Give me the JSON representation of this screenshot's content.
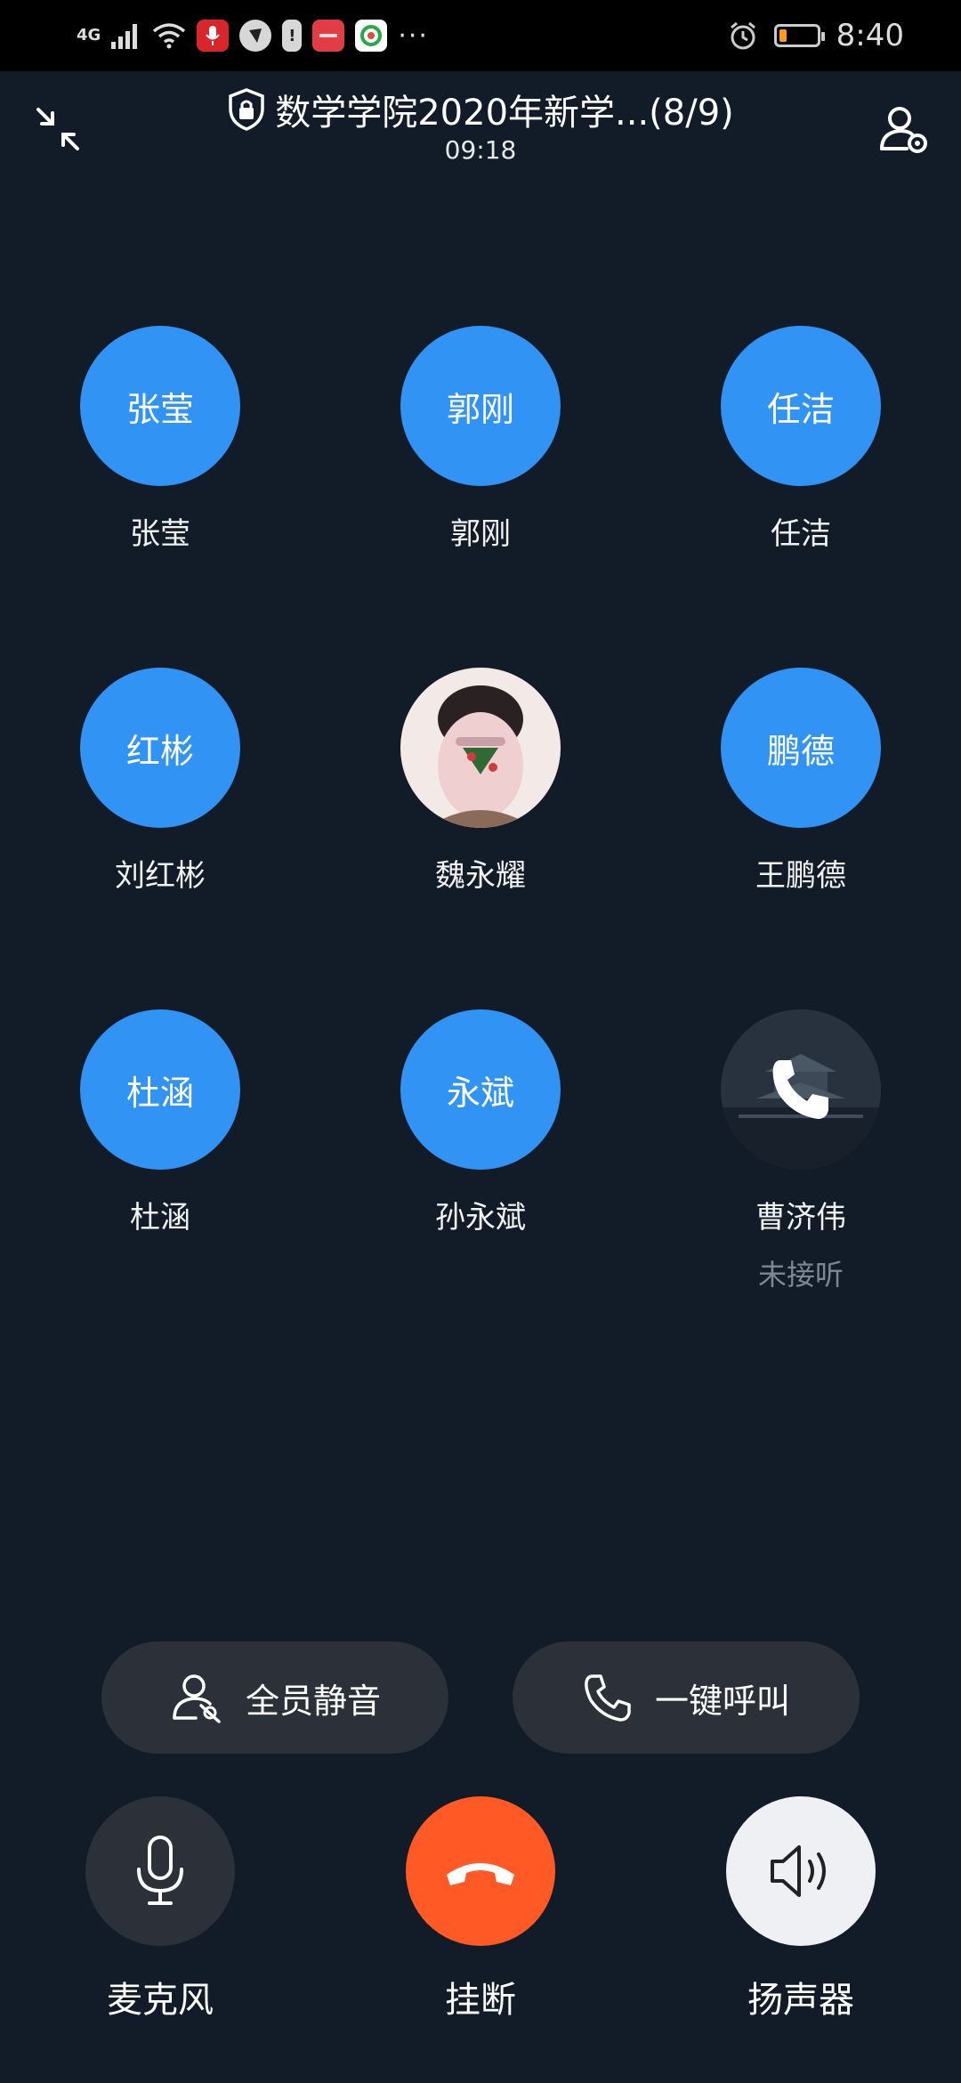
{
  "status_bar": {
    "network": "4G",
    "time": "8:40",
    "more": "···",
    "icons": [
      "signal-icon",
      "wifi-icon",
      "mic-app-icon",
      "shield-app-icon",
      "alert-icon",
      "huawei-app-icon",
      "camera-app-icon",
      "alarm-icon",
      "battery-icon"
    ],
    "battery_color": "#ff9a1f"
  },
  "header": {
    "title": "数学学院2020年新学...(8/9)",
    "duration": "09:18"
  },
  "participants": [
    {
      "avatar_text": "张莹",
      "name": "张莹"
    },
    {
      "avatar_text": "郭刚",
      "name": "郭刚"
    },
    {
      "avatar_text": "任洁",
      "name": "任洁"
    },
    {
      "avatar_text": "红彬",
      "name": "刘红彬"
    },
    {
      "avatar_text": "",
      "name": "魏永耀"
    },
    {
      "avatar_text": "鹏德",
      "name": "王鹏德"
    },
    {
      "avatar_text": "杜涵",
      "name": "杜涵"
    },
    {
      "avatar_text": "永斌",
      "name": "孙永斌"
    },
    {
      "avatar_text": "",
      "name": "曹济伟",
      "status": "未接听"
    }
  ],
  "actions": {
    "mute_all": "全员静音",
    "call_all": "一键呼叫"
  },
  "controls": {
    "microphone": "麦克风",
    "hangup": "挂断",
    "speaker": "扬声器"
  },
  "colors": {
    "background": "#121c29",
    "avatar_blue": "#3193f4",
    "hangup_red": "#ff5a26",
    "pill_bg": "#2c3038"
  }
}
